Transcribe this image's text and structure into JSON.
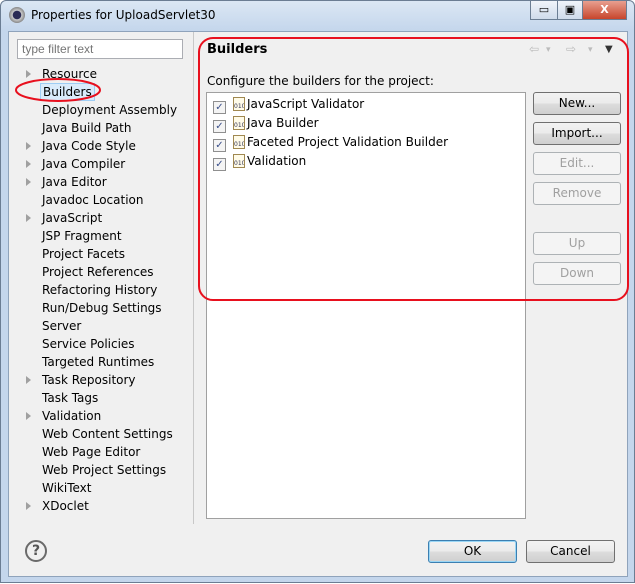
{
  "window": {
    "title": "Properties for UploadServlet30",
    "minimize": "▭",
    "maximize": "▣",
    "close": "X"
  },
  "filter": {
    "placeholder": "type filter text"
  },
  "tree": [
    {
      "label": "Resource",
      "expandable": true
    },
    {
      "label": "Builders",
      "expandable": false,
      "selected": true
    },
    {
      "label": "Deployment Assembly",
      "expandable": false
    },
    {
      "label": "Java Build Path",
      "expandable": false
    },
    {
      "label": "Java Code Style",
      "expandable": true
    },
    {
      "label": "Java Compiler",
      "expandable": true
    },
    {
      "label": "Java Editor",
      "expandable": true
    },
    {
      "label": "Javadoc Location",
      "expandable": false
    },
    {
      "label": "JavaScript",
      "expandable": true
    },
    {
      "label": "JSP Fragment",
      "expandable": false
    },
    {
      "label": "Project Facets",
      "expandable": false
    },
    {
      "label": "Project References",
      "expandable": false
    },
    {
      "label": "Refactoring History",
      "expandable": false
    },
    {
      "label": "Run/Debug Settings",
      "expandable": false
    },
    {
      "label": "Server",
      "expandable": false
    },
    {
      "label": "Service Policies",
      "expandable": false
    },
    {
      "label": "Targeted Runtimes",
      "expandable": false
    },
    {
      "label": "Task Repository",
      "expandable": true
    },
    {
      "label": "Task Tags",
      "expandable": false
    },
    {
      "label": "Validation",
      "expandable": true
    },
    {
      "label": "Web Content Settings",
      "expandable": false
    },
    {
      "label": "Web Page Editor",
      "expandable": false
    },
    {
      "label": "Web Project Settings",
      "expandable": false
    },
    {
      "label": "WikiText",
      "expandable": false
    },
    {
      "label": "XDoclet",
      "expandable": true
    }
  ],
  "page": {
    "title": "Builders",
    "description": "Configure the builders for the project:",
    "nav": {
      "back": "⇦",
      "forward": "⇨",
      "dropdown": "▾",
      "menu": "▼"
    }
  },
  "builders": [
    {
      "label": "JavaScript Validator",
      "checked": true
    },
    {
      "label": "Java Builder",
      "checked": true
    },
    {
      "label": "Faceted Project Validation Builder",
      "checked": true
    },
    {
      "label": "Validation",
      "checked": true
    }
  ],
  "buttons": [
    {
      "label": "New...",
      "enabled": true
    },
    {
      "label": "Import...",
      "enabled": true
    },
    {
      "label": "Edit...",
      "enabled": false
    },
    {
      "label": "Remove",
      "enabled": false
    },
    {
      "label": "Up",
      "enabled": false
    },
    {
      "label": "Down",
      "enabled": false
    }
  ],
  "footer": {
    "help": "?",
    "ok": "OK",
    "cancel": "Cancel"
  },
  "annotation_color": "#e8101e"
}
